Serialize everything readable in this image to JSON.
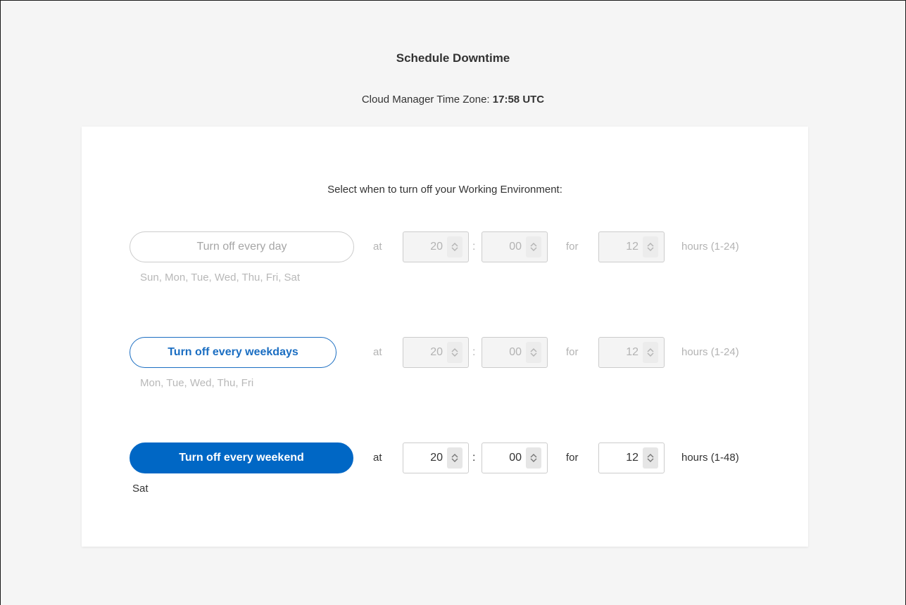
{
  "header": {
    "title": "Schedule Downtime",
    "timezone_label": "Cloud Manager Time Zone:",
    "timezone_value": "17:58 UTC"
  },
  "card": {
    "instruction": "Select when to turn off your Working Environment:",
    "options": [
      {
        "button_label": "Turn off every day",
        "days": "Sun, Mon, Tue, Wed, Thu, Fri, Sat",
        "state": "inactive",
        "at_label": "at",
        "hour": "20",
        "minute": "00",
        "for_label": "for",
        "duration": "12",
        "range_label": "hours (1-24)"
      },
      {
        "button_label": "Turn off every weekdays",
        "days": "Mon, Tue, Wed, Thu, Fri",
        "state": "outlined",
        "at_label": "at",
        "hour": "20",
        "minute": "00",
        "for_label": "for",
        "duration": "12",
        "range_label": "hours (1-24)"
      },
      {
        "button_label": "Turn off every weekend",
        "days": "Sat",
        "state": "selected",
        "at_label": "at",
        "hour": "20",
        "minute": "00",
        "for_label": "for",
        "duration": "12",
        "range_label": "hours (1-48)"
      }
    ],
    "colon": ":"
  },
  "colors": {
    "accent": "#0067c5",
    "background": "#f5f5f5",
    "card": "#ffffff",
    "muted_text": "#b3b3b3"
  }
}
